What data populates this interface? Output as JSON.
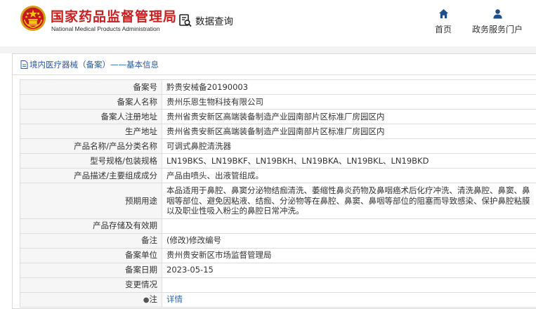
{
  "header": {
    "org_name": "国家药品监督管理局",
    "org_name_en": "National Medical Products Administration",
    "query_label": "数据查询",
    "nav": [
      {
        "label": "首页",
        "icon": "home-icon"
      },
      {
        "label": "政务服务门户",
        "icon": "user-icon"
      }
    ]
  },
  "colors": {
    "brand_red": "#c71f1f",
    "link_blue": "#2c64b4",
    "title_blue": "#2c5aa0"
  },
  "panel": {
    "title": "境内医疗器械（备案）——基本信息",
    "rows": [
      {
        "label": "备案号",
        "value": "黔贵安械备20190003"
      },
      {
        "label": "备案人名称",
        "value": "贵州乐恩生物科技有限公司"
      },
      {
        "label": "备案人注册地址",
        "value": "贵州省贵安新区高端装备制造产业园南部片区标准厂房园区内"
      },
      {
        "label": "生产地址",
        "value": "贵州省贵安新区高端装备制造产业园南部片区标准厂房园区内"
      },
      {
        "label": "产品名称/产品分类名称",
        "value": "可调式鼻腔清洗器"
      },
      {
        "label": "型号规格/包装规格",
        "value": "LN19BKS、LN19BKF、LN19BKH、LN19BKA、LN19BKL、LN19BKD"
      },
      {
        "label": "产品描述/主要组成成分",
        "value": "产品由喷头、出液管组成。"
      },
      {
        "label": "预期用途",
        "value": "本品适用于鼻腔、鼻窦分泌物结痂清洗、萎缩性鼻炎药物及鼻咽癌术后化疗冲洗、清洗鼻腔、鼻窦、鼻咽等部位、避免因粘液、结痂、分泌物等在鼻腔、鼻窦、鼻咽等部位的阻塞而导致感染、保护鼻腔粘膜以及职业性吸入粉尘的鼻腔日常冲洗。"
      },
      {
        "label": "产品存储及有效期",
        "value": ""
      },
      {
        "label": "备注",
        "value": "(修改)修改编号"
      },
      {
        "label": "备案单位",
        "value": "贵州贵安新区市场监督管理局"
      },
      {
        "label": "备案日期",
        "value": "2023-05-15"
      },
      {
        "label": "变更情况",
        "value": ""
      },
      {
        "label": "注",
        "value": "详情"
      }
    ]
  }
}
